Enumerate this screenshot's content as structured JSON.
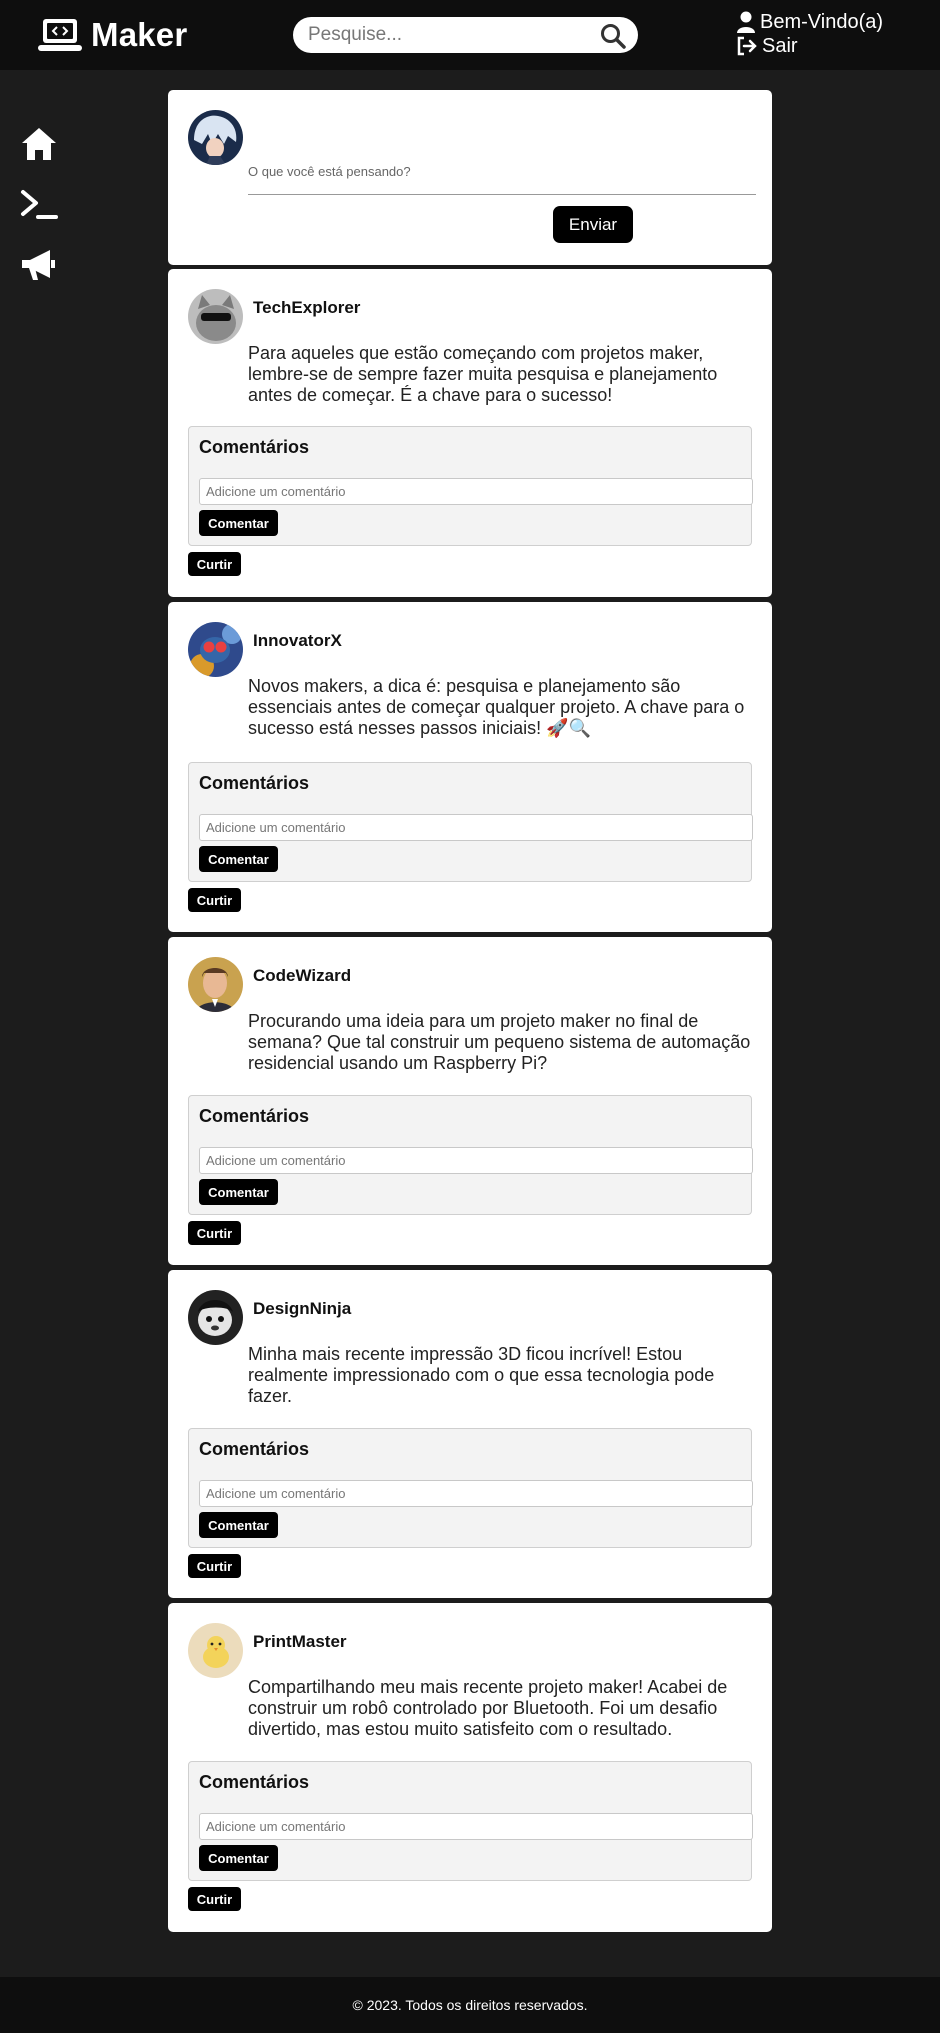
{
  "header": {
    "app_name": "Maker",
    "search_placeholder": "Pesquise...",
    "welcome": "Bem-Vindo(a)",
    "logout": "Sair"
  },
  "sidebar": {
    "items": [
      {
        "icon": "home-icon"
      },
      {
        "icon": "terminal-icon"
      },
      {
        "icon": "megaphone-icon"
      }
    ]
  },
  "composer": {
    "placeholder": "O que você está pensando?",
    "send_label": "Enviar"
  },
  "comments_title": "Comentários",
  "comment_placeholder": "Adicione um comentário",
  "comment_button": "Comentar",
  "like_button": "Curtir",
  "posts": [
    {
      "username": "TechExplorer",
      "text": "Para aqueles que estão começando com projetos maker, lembre-se de sempre fazer muita pesquisa e planejamento antes de começar. É a chave para o sucesso!"
    },
    {
      "username": "InnovatorX",
      "text": "Novos makers, a dica é: pesquisa e planejamento são essenciais antes de começar qualquer projeto. A chave para o sucesso está nesses passos iniciais! 🚀🔍"
    },
    {
      "username": "CodeWizard",
      "text": "Procurando uma ideia para um projeto maker no final de semana? Que tal construir um pequeno sistema de automação residencial usando um Raspberry Pi?"
    },
    {
      "username": "DesignNinja",
      "text": "Minha mais recente impressão 3D ficou incrível! Estou realmente impressionado com o que essa tecnologia pode fazer."
    },
    {
      "username": "PrintMaster",
      "text": "Compartilhando meu mais recente projeto maker! Acabei de construir um robô controlado por Bluetooth. Foi um desafio divertido, mas estou muito satisfeito com o resultado."
    }
  ],
  "footer": {
    "text": "© 2023. Todos os direitos reservados."
  },
  "colors": {
    "background": "#1c1c1c",
    "topbar": "#0e0e0e",
    "card": "#ffffff",
    "button": "#000000"
  }
}
